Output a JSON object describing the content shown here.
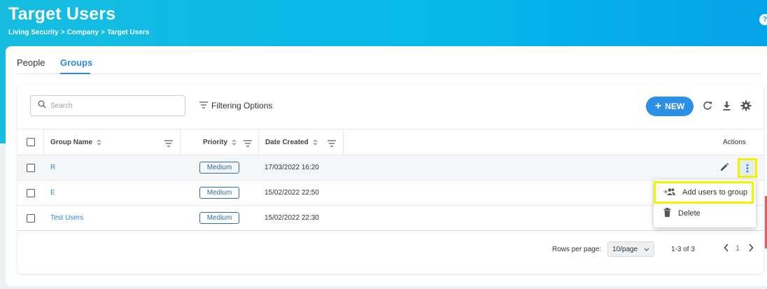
{
  "header": {
    "title": "Target Users",
    "breadcrumb": [
      "Living Security",
      ">",
      "Company",
      ">",
      "Target Users"
    ],
    "help_glyph": "?"
  },
  "tabs": [
    {
      "label": "People",
      "active": false
    },
    {
      "label": "Groups",
      "active": true
    }
  ],
  "toolbar": {
    "search_placeholder": "Search",
    "filtering_label": "Filtering Options",
    "new_label": "NEW"
  },
  "table": {
    "columns": [
      "Group Name",
      "Priority",
      "Date Created",
      "Actions"
    ],
    "rows": [
      {
        "name": "R",
        "priority": "Medium",
        "date": "17/03/2022 16:20"
      },
      {
        "name": "E",
        "priority": "Medium",
        "date": "15/02/2022 22:50"
      },
      {
        "name": "Test Users",
        "priority": "Medium",
        "date": "15/02/2022 22:30"
      }
    ]
  },
  "context_menu": {
    "add_label": "Add users to group",
    "delete_label": "Delete"
  },
  "pagination": {
    "rows_per_page_label": "Rows per page:",
    "rows_per_page_value": "10/page",
    "range": "1-3 of 3",
    "current_page": "1"
  },
  "colors": {
    "accent": "#2c8ad9",
    "highlight": "#f2f200",
    "header_gradient_start": "#16bde0"
  }
}
